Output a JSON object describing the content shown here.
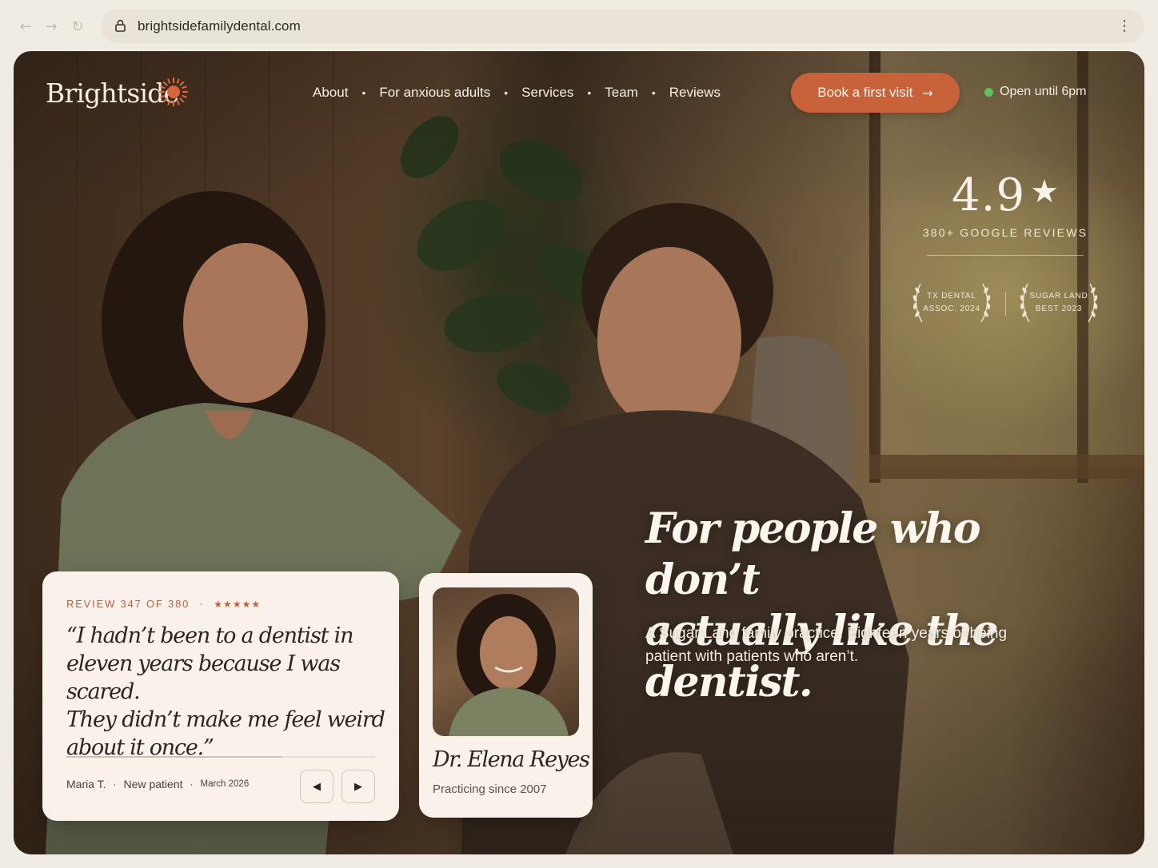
{
  "browser": {
    "url": "brightsidefamilydental.com",
    "back_icon": "←",
    "forward_icon": "→",
    "reload_icon": "↻",
    "menu_icon": "⋮"
  },
  "brand": {
    "name": "Brightside",
    "accent": "#c8623a"
  },
  "nav": {
    "items": [
      "About",
      "For anxious adults",
      "Services",
      "Team",
      "Reviews"
    ],
    "separator": "•"
  },
  "cta": {
    "label": "Book a first visit",
    "icon": "→"
  },
  "status": {
    "label": "Open until 6pm",
    "color": "#5cc25a"
  },
  "rating": {
    "score": "4.9",
    "star": "★",
    "reviews_label": "380+ GOOGLE REVIEWS",
    "awards": [
      {
        "line1": "TX DENTAL",
        "line2": "ASSOC. 2024"
      },
      {
        "line1": "SUGAR LAND",
        "line2": "BEST 2023"
      }
    ]
  },
  "hero": {
    "headline_line1": "For people who don’t",
    "headline_line2": "actually like the dentist.",
    "sub_line1": "A Sugar Land family practice. Eighteen years of being",
    "sub_line2": "patient with patients who aren’t."
  },
  "review": {
    "counter": "REVIEW 347 OF 380",
    "separator": "·",
    "stars": "★★★★★",
    "quote_lines": [
      "“I hadn’t been to a dentist in",
      "eleven years because I was scared.",
      "They didn’t make me feel weird",
      "about it once.”"
    ],
    "progress": 0.7,
    "author": "Maria T.",
    "author_type": "New patient",
    "date": "March 2026",
    "prev_icon": "◀",
    "next_icon": "▶"
  },
  "doctor": {
    "name": "Dr. Elena Reyes",
    "since": "Practicing since 2007"
  }
}
